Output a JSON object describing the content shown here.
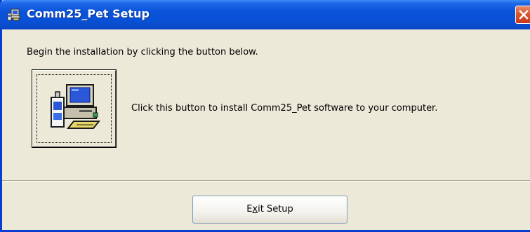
{
  "window": {
    "title": "Comm25_Pet Setup",
    "app_icon": "setup-computer-icon",
    "close_icon": "close-icon"
  },
  "main": {
    "instruction": "Begin the installation by clicking the button below.",
    "install_button_icon": "setup-computer-icon",
    "install_caption": "Click this button to install Comm25_Pet software to your computer."
  },
  "footer": {
    "exit_label_pre": "E",
    "exit_label_mnemonic": "x",
    "exit_label_post": "it Setup"
  },
  "colors": {
    "titlebar": "#0a53d9",
    "window_bg": "#ece9d8",
    "close_button": "#d9522b"
  }
}
